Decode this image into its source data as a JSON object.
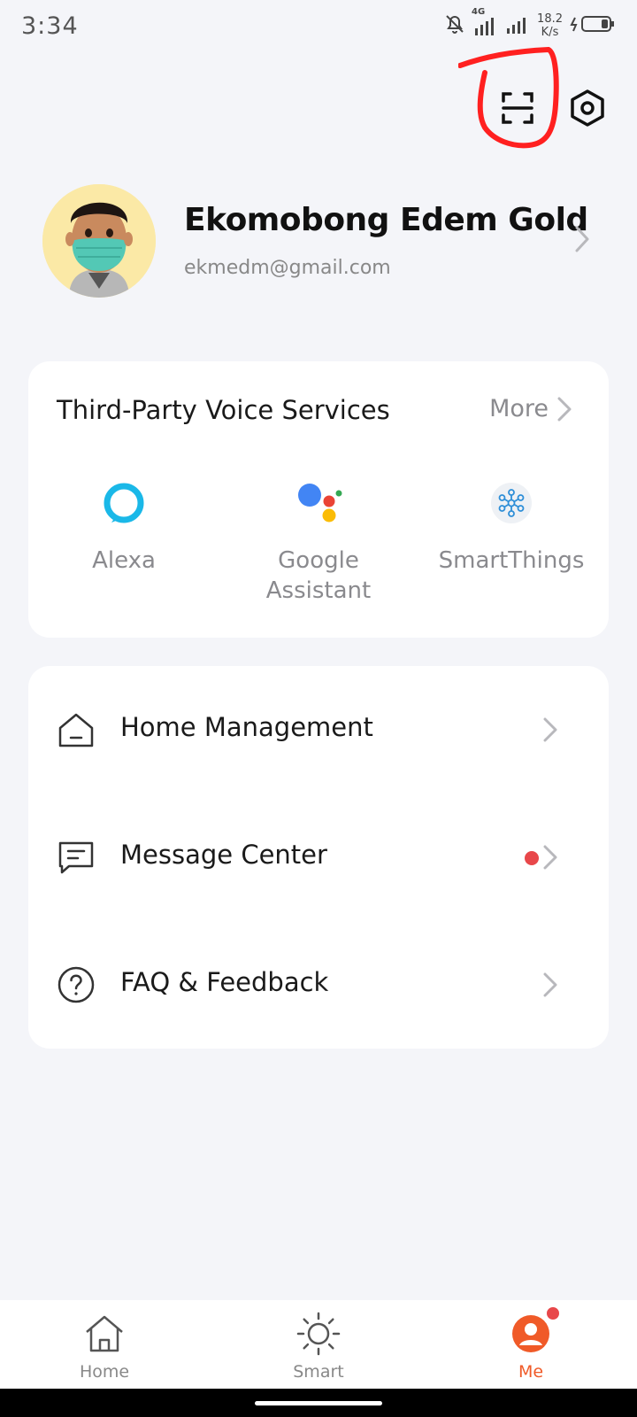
{
  "status_bar": {
    "time": "3:34",
    "network": "4G",
    "speed_value": "18.2",
    "speed_unit": "K/s"
  },
  "top_actions": {
    "scan_icon": "scan-icon",
    "settings_icon": "settings-hex-icon",
    "annotation_color": "#ff2020"
  },
  "profile": {
    "name": "Ekomobong Edem Gold",
    "email": "ekmedm@gmail.com"
  },
  "voice_services": {
    "title": "Third-Party Voice Services",
    "more_label": "More",
    "services": [
      {
        "label": "Alexa",
        "icon": "alexa-icon"
      },
      {
        "label": "Google Assistant",
        "icon": "google-assistant-icon"
      },
      {
        "label": "SmartThings",
        "icon": "smartthings-icon"
      }
    ]
  },
  "menu": {
    "items": [
      {
        "label": "Home Management",
        "icon": "house-icon",
        "badge": false
      },
      {
        "label": "Message Center",
        "icon": "message-icon",
        "badge": true
      },
      {
        "label": "FAQ & Feedback",
        "icon": "help-icon",
        "badge": false
      }
    ]
  },
  "bottom_nav": {
    "items": [
      {
        "label": "Home",
        "icon": "home-tab-icon",
        "active": false
      },
      {
        "label": "Smart",
        "icon": "sun-icon",
        "active": false
      },
      {
        "label": "Me",
        "icon": "person-icon",
        "active": true
      }
    ]
  },
  "colors": {
    "accent": "#f05a28",
    "badge": "#e8474a",
    "background": "#f4f5f9",
    "card": "#ffffff"
  }
}
